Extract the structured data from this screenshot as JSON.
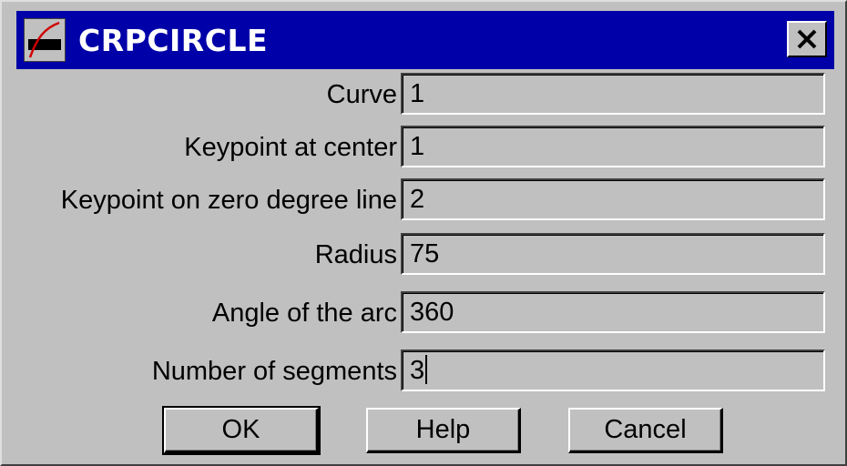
{
  "window": {
    "title": "CRPCIRCLE",
    "colors": {
      "titlebar": "#0000a8",
      "face": "#c0c0c0"
    },
    "icons": {
      "app": "curve-icon",
      "close": "close-icon"
    }
  },
  "fields": [
    {
      "label": "Curve",
      "value": "1"
    },
    {
      "label": "Keypoint at center",
      "value": "1"
    },
    {
      "label": "Keypoint on zero degree line",
      "value": "2"
    },
    {
      "label": "Radius",
      "value": "75"
    },
    {
      "label": "Angle of the arc",
      "value": "360"
    },
    {
      "label": "Number of segments",
      "value": "3"
    }
  ],
  "buttons": {
    "ok": "OK",
    "help": "Help",
    "cancel": "Cancel"
  }
}
